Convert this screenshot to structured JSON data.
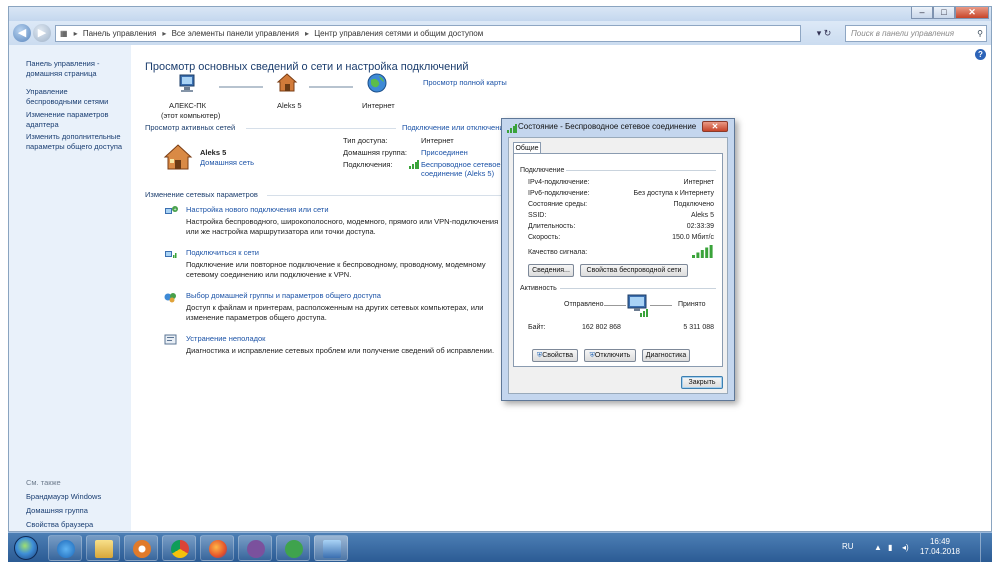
{
  "window": {
    "breadcrumb": [
      "Панель управления",
      "Все элементы панели управления",
      "Центр управления сетями и общим доступом"
    ],
    "search_placeholder": "Поиск в панели управления"
  },
  "sidebar": {
    "links": [
      "Панель управления - домашняя страница",
      "Управление беспроводными сетями",
      "Изменение параметров адаптера",
      "Изменить дополнительные параметры общего доступа"
    ],
    "see_also_header": "См. также",
    "see_also": [
      "Брандмауэр Windows",
      "Домашняя группа",
      "Свойства браузера"
    ]
  },
  "main": {
    "title": "Просмотр основных сведений о сети и настройка подключений",
    "map_link": "Просмотр полной карты",
    "map_nodes": [
      {
        "label": "АЛЕКС-ПК",
        "sublabel": "(этот компьютер)"
      },
      {
        "label": "Aleks 5"
      },
      {
        "label": "Интернет"
      }
    ],
    "active_header": "Просмотр активных сетей",
    "connect_link": "Подключение или отключение",
    "network_name": "Aleks 5",
    "network_type": "Домашняя сеть",
    "access_type_label": "Тип доступа:",
    "access_type_value": "Интернет",
    "homegroup_label": "Домашняя группа:",
    "homegroup_value": "Присоединен",
    "connections_label": "Подключения:",
    "connections_value_1": "Беспроводное сетевое",
    "connections_value_2": "соединение (Aleks 5)",
    "change_header": "Изменение сетевых параметров",
    "tasks": [
      {
        "link": "Настройка нового подключения или сети",
        "desc1": "Настройка беспроводного, широкополосного, модемного, прямого или VPN-подключения",
        "desc2": "или же настройка маршрутизатора или точки доступа."
      },
      {
        "link": "Подключиться к сети",
        "desc1": "Подключение или повторное подключение к беспроводному, проводному, модемному",
        "desc2": "сетевому соединению или подключение к VPN."
      },
      {
        "link": "Выбор домашней группы и параметров общего доступа",
        "desc1": "Доступ к файлам и принтерам, расположенным на других сетевых компьютерах, или",
        "desc2": "изменение параметров общего доступа."
      },
      {
        "link": "Устранение неполадок",
        "desc1": "Диагностика и исправление сетевых проблем или получение сведений об исправлении.",
        "desc2": ""
      }
    ]
  },
  "dialog": {
    "title": "Состояние - Беспроводное сетевое соединение",
    "tab": "Общие",
    "connection_header": "Подключение",
    "rows": [
      {
        "label": "IPv4-подключение:",
        "value": "Интернет"
      },
      {
        "label": "IPv6-подключение:",
        "value": "Без доступа к Интернету"
      },
      {
        "label": "Состояние среды:",
        "value": "Подключено"
      },
      {
        "label": "SSID:",
        "value": "Aleks 5"
      },
      {
        "label": "Длительность:",
        "value": "02:33:39"
      },
      {
        "label": "Скорость:",
        "value": "150.0 Мбит/с"
      }
    ],
    "signal_label": "Качество сигнала:",
    "signal_bars": 5,
    "details_button": "Сведения...",
    "wireless_props_button": "Свойства беспроводной сети",
    "activity_header": "Активность",
    "sent_label": "Отправлено",
    "received_label": "Принято",
    "bytes_label": "Байт:",
    "bytes_sent": "162 802 868",
    "bytes_received": "5 311 088",
    "properties_button": "Свойства",
    "disable_button": "Отключить",
    "diagnose_button": "Диагностика",
    "close_button": "Закрыть"
  },
  "taskbar": {
    "lang": "RU",
    "time": "16:49",
    "date": "17.04.2018"
  },
  "colors": {
    "link": "#1c53a7",
    "heading": "#1c3e6e",
    "signal": "#3aa33a"
  }
}
